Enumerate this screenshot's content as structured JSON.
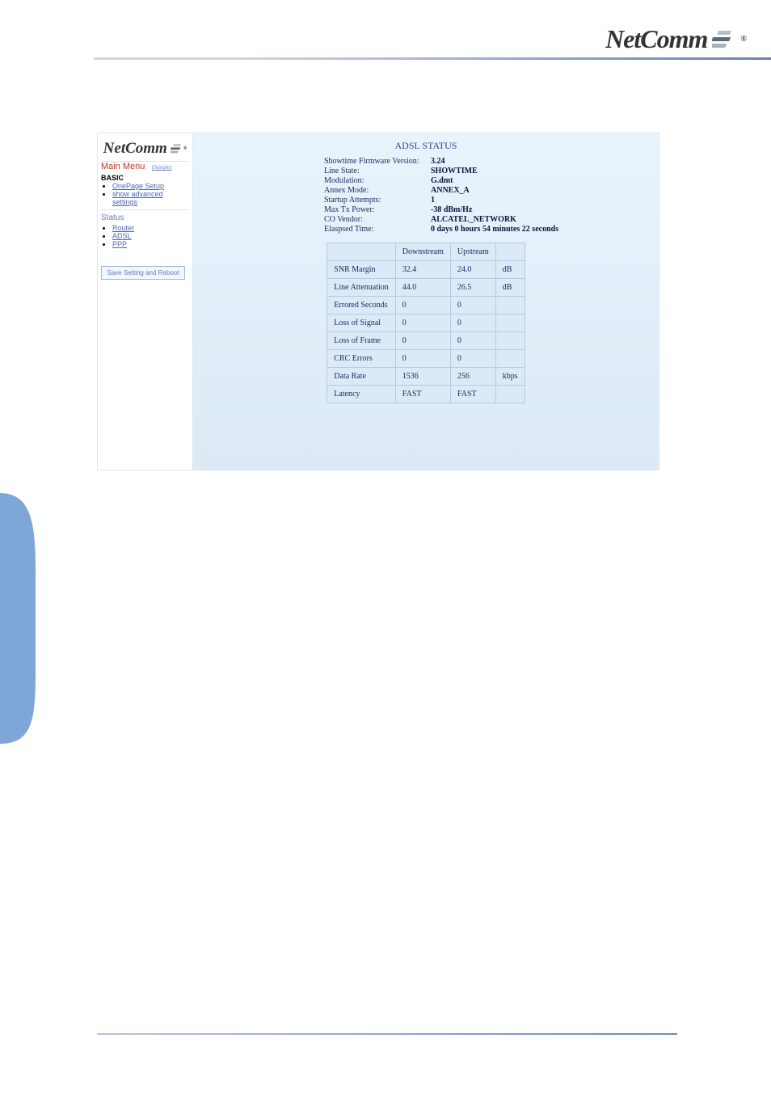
{
  "header": {
    "logo_text": "NetComm"
  },
  "sidebar": {
    "logo_text": "NetComm",
    "main_menu_label": "Main Menu",
    "mode_link": "(Simple)",
    "basic_label": "BASIC",
    "basic_items": [
      {
        "label": "OnePage Setup"
      },
      {
        "label": "show advanced settings"
      }
    ],
    "status_label": "Status",
    "status_items": [
      {
        "label": "Router"
      },
      {
        "label": "ADSL"
      },
      {
        "label": "PPP"
      }
    ],
    "save_btn_label": "Save Setting and Reboot"
  },
  "main": {
    "title": "ADSL STATUS",
    "kv": [
      {
        "label": "Showtime Firmware Version:",
        "value": "3.24"
      },
      {
        "label": "Line State:",
        "value": "SHOWTIME"
      },
      {
        "label": "Modulation:",
        "value": "G.dmt"
      },
      {
        "label": "Annex Mode:",
        "value": "ANNEX_A"
      },
      {
        "label": "Startup Attempts:",
        "value": "1"
      },
      {
        "label": "Max Tx Power:",
        "value": "-38 dBm/Hz"
      },
      {
        "label": "CO Vendor:",
        "value": "ALCATEL_NETWORK"
      },
      {
        "label": "Elaspsed Time:",
        "value": "0 days 0 hours 54 minutes 22 seconds"
      }
    ],
    "table_headers": {
      "downstream": "Downstream",
      "upstream": "Upstream"
    },
    "rows": [
      {
        "label": "SNR Margin",
        "down": "32.4",
        "up": "24.0",
        "unit": "dB"
      },
      {
        "label": "Line Attenuation",
        "down": "44.0",
        "up": "26.5",
        "unit": "dB"
      },
      {
        "label": "Errored Seconds",
        "down": "0",
        "up": "0",
        "unit": ""
      },
      {
        "label": "Loss of Signal",
        "down": "0",
        "up": "0",
        "unit": ""
      },
      {
        "label": "Loss of Frame",
        "down": "0",
        "up": "0",
        "unit": ""
      },
      {
        "label": "CRC Errors",
        "down": "0",
        "up": "0",
        "unit": ""
      },
      {
        "label": "Data Rate",
        "down": "1536",
        "up": "256",
        "unit": "kbps"
      },
      {
        "label": "Latency",
        "down": "FAST",
        "up": "FAST",
        "unit": ""
      }
    ]
  }
}
